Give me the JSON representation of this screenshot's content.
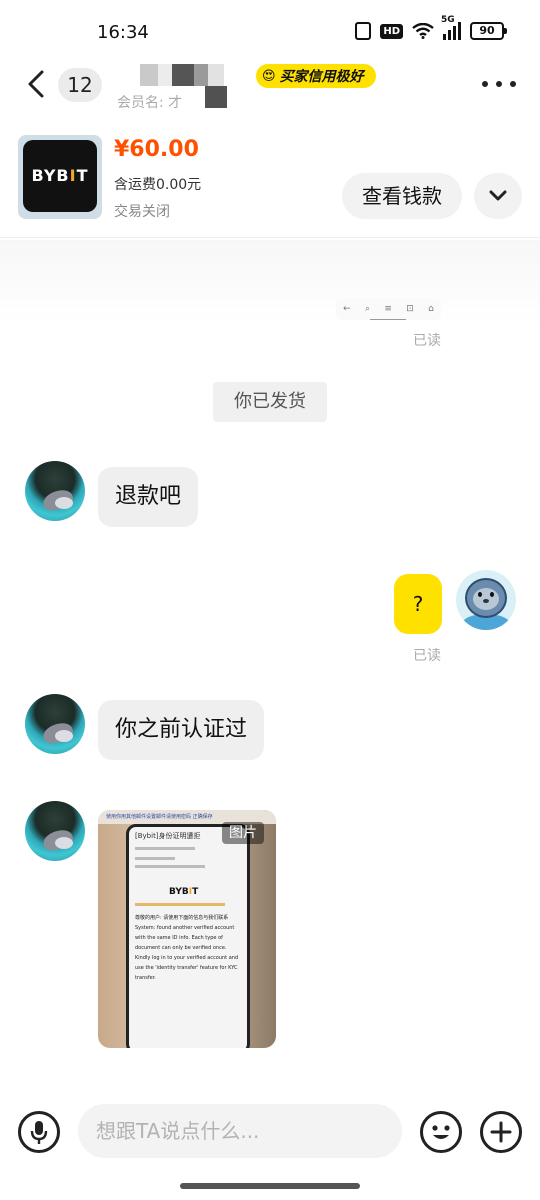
{
  "status_bar": {
    "time": "16:34",
    "hd_label": "HD",
    "signal_label": "5G",
    "battery_level": "90"
  },
  "header": {
    "back_icon": "chevron-left-icon",
    "unread_count": "12",
    "member_label": "会员名: 才",
    "credit_tag": "买家信用极好",
    "credit_emoji": "😍",
    "more_icon": "more-dots-icon"
  },
  "order": {
    "brand_logo": "BYB|T",
    "price": "¥60.00",
    "shipping": "含运费0.00元",
    "status": "交易关闭",
    "view_money_label": "查看钱款",
    "expand_icon": "chevron-down-icon"
  },
  "chat": {
    "mini_toolbar_icons": [
      "←",
      "⌕",
      "≡",
      "⊡",
      "⌂"
    ],
    "read_label_1": "已读",
    "system_message": "你已发货",
    "messages": [
      {
        "side": "left",
        "text": "退款吧"
      },
      {
        "side": "right",
        "text": "?"
      },
      {
        "side": "left",
        "text": "你之前认证过"
      }
    ],
    "read_label_2": "已读",
    "image_message": {
      "badge": "图片",
      "top_text": "使用你用其他邮件设置邮件请使用密码 正确保存",
      "mail_title": "[Bybit]身份证明遭拒",
      "logo": "BYB|T",
      "body": "尊敬的用户: 请使用下面的信息与我们联系 System: found another verified account with the same ID info. Each type of document can only be verified once. Kindly log in to your verified account and use the 'identity transfer' feature for KYC transfer."
    }
  },
  "input_bar": {
    "placeholder": "想跟TA说点什么...",
    "mic_icon": "microphone-icon",
    "emoji_icon": "smiley-icon",
    "plus_icon": "plus-icon"
  },
  "colors": {
    "accent_yellow": "#ffe100",
    "price_orange": "#ff5000"
  }
}
